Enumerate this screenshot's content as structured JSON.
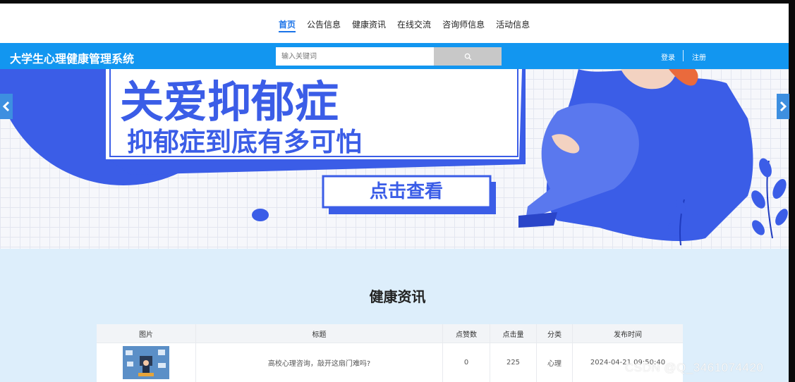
{
  "nav": {
    "items": [
      {
        "label": "首页",
        "active": true
      },
      {
        "label": "公告信息",
        "active": false
      },
      {
        "label": "健康资讯",
        "active": false
      },
      {
        "label": "在线交流",
        "active": false
      },
      {
        "label": "咨询师信息",
        "active": false
      },
      {
        "label": "活动信息",
        "active": false
      }
    ]
  },
  "header": {
    "title": "大学生心理健康管理系统",
    "search_placeholder": "输入关键词",
    "login": "登录",
    "register": "注册",
    "color": "#1296f0"
  },
  "banner": {
    "headline": "关爱抑郁症",
    "subhead": "抑郁症到底有多可怕",
    "button": "点击查看",
    "accent": "#3b5de7"
  },
  "section": {
    "title": "健康资讯",
    "columns": [
      "图片",
      "标题",
      "点赞数",
      "点击量",
      "分类",
      "发布时间"
    ],
    "rows": [
      {
        "title": "高校心理咨询，敲开这扇门难吗?",
        "likes": "0",
        "clicks": "225",
        "category": "心理",
        "time": "2024-04-21 09:50:40"
      }
    ]
  },
  "watermark": "CSDN @Q_3461074420"
}
